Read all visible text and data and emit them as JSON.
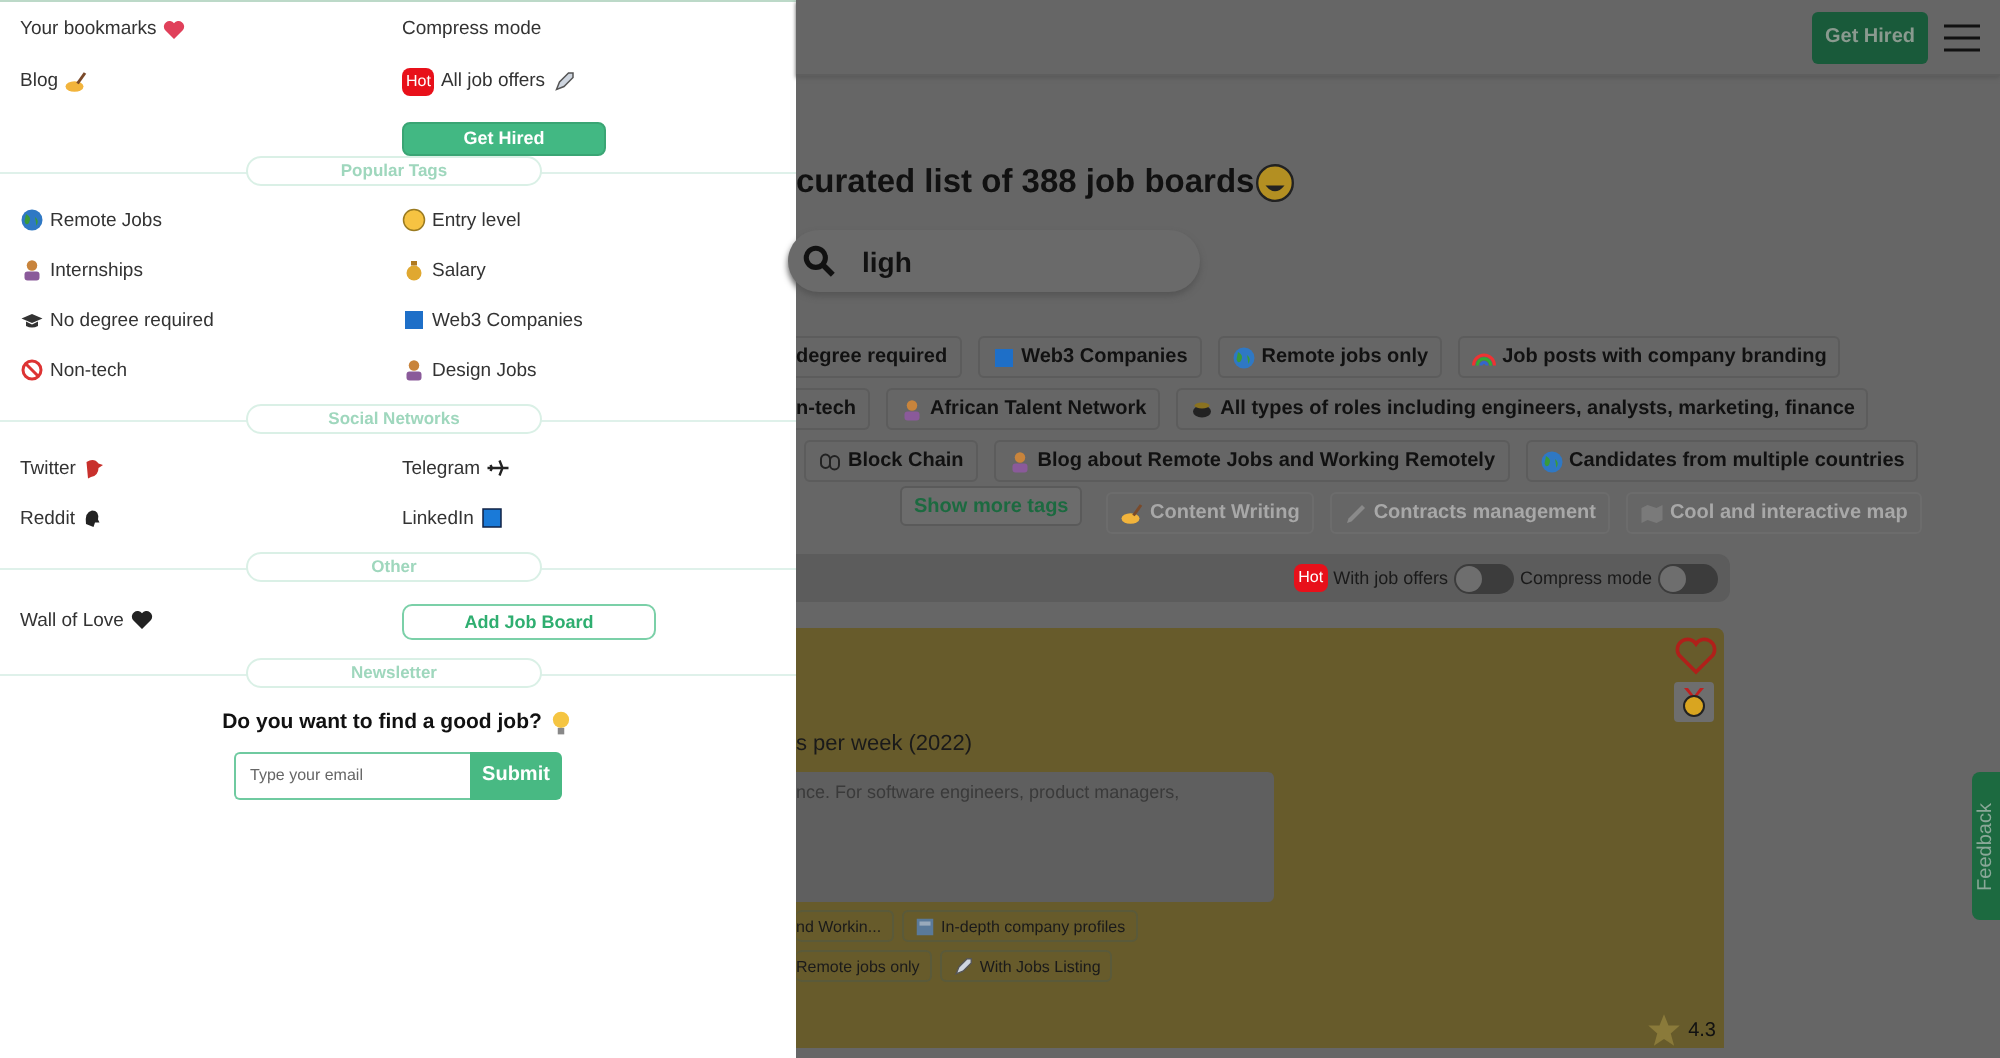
{
  "drawer": {
    "links": [
      {
        "label": "Your bookmarks"
      },
      {
        "label": "Compress mode"
      },
      {
        "label": "Blog"
      },
      {
        "label": "All job offers",
        "badge": "Hot"
      }
    ],
    "get_hired": "Get Hired",
    "sections": [
      {
        "title": "Popular Tags",
        "items": [
          {
            "kind": "link",
            "label": "Remote Jobs"
          },
          {
            "kind": "link",
            "label": "Entry level"
          },
          {
            "kind": "link",
            "label": "Internships"
          },
          {
            "kind": "link",
            "label": "Salary"
          },
          {
            "kind": "link",
            "label": "No degree required"
          },
          {
            "kind": "link",
            "label": "Web3 Companies"
          },
          {
            "kind": "link",
            "label": "Non-tech"
          },
          {
            "kind": "link",
            "label": "Design Jobs"
          }
        ]
      },
      {
        "title": "Social Networks",
        "items": [
          {
            "kind": "link",
            "label": "Twitter"
          },
          {
            "kind": "link",
            "label": "Telegram"
          },
          {
            "kind": "link",
            "label": "Reddit"
          },
          {
            "kind": "link",
            "label": "LinkedIn"
          }
        ]
      },
      {
        "title": "Other",
        "items": [
          {
            "kind": "link",
            "label": "Wall of Love"
          },
          {
            "kind": "button",
            "label": "Add Job Board"
          }
        ]
      }
    ],
    "newsletter": {
      "title": "Newsletter",
      "question": "Do you want to find a good job?",
      "placeholder": "Type your email",
      "submit": "Submit"
    }
  },
  "page": {
    "get_hired": "Get Hired",
    "heading": "curated list of 388 job boards",
    "search": {
      "value": "ligh"
    },
    "tag_rows": [
      [
        "degree required",
        "Web3 Companies",
        "Remote jobs only",
        "Job posts with company branding"
      ],
      [
        "n-tech",
        "African Talent Network",
        "All types of roles including engineers, analysts, marketing, finance"
      ],
      [
        "Block Chain",
        "Blog about Remote Jobs and Working Remotely",
        "Candidates from multiple countries"
      ]
    ],
    "faded_tags": [
      "Content Writing",
      "Contracts management",
      "Cool and interactive map"
    ],
    "show_more": "Show more tags",
    "toggles": [
      {
        "label": "With job offers",
        "badge": "Hot",
        "on": false
      },
      {
        "label": "Compress mode",
        "on": false
      }
    ],
    "card": {
      "subtitle": "s per week (2022)",
      "description": "nce. For software engineers, product managers,",
      "tags": [
        [
          "nd Workin...",
          "In-depth company profiles"
        ],
        [
          "Remote jobs only",
          "With Jobs Listing"
        ]
      ],
      "rating": "4.3"
    },
    "feedback": "Feedback"
  }
}
